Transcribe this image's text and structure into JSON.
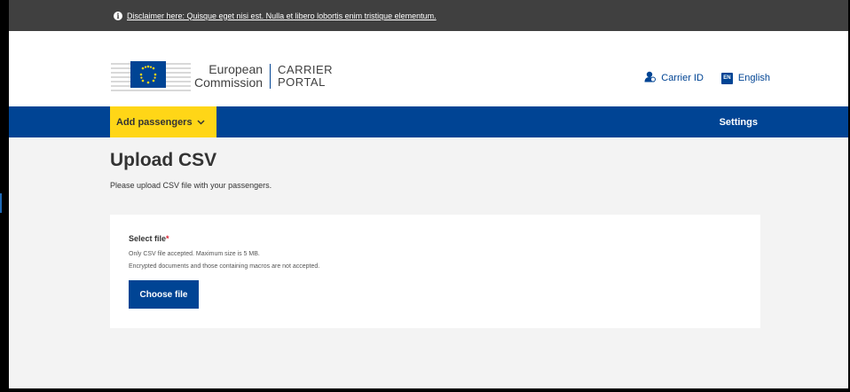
{
  "disclaimer": {
    "text": "Disclaimer here: Quisque eget nisi est. Nulla et libero lobortis enim tristique elementum."
  },
  "header": {
    "logo_line1": "European",
    "logo_line2": "Commission",
    "portal_line1": "CARRIER",
    "portal_line2": "PORTAL",
    "carrier_id_label": "Carrier ID",
    "language_code": "EN",
    "language_label": "English"
  },
  "nav": {
    "add_passengers_label": "Add passengers",
    "settings_label": "Settings"
  },
  "main": {
    "title": "Upload CSV",
    "subtitle": "Please upload CSV file with your passengers.",
    "card": {
      "label": "Select file",
      "required_mark": "*",
      "help1": "Only CSV file accepted. Maximum size is 5 MB.",
      "help2": "Encrypted documents and those containing macros are not accepted.",
      "button_label": "Choose file"
    }
  },
  "colors": {
    "primary": "#004494",
    "accent": "#ffd617",
    "disclaimer_bg": "#404040",
    "page_bg": "#f3f3f3"
  },
  "icons": [
    "info-icon",
    "eu-flag-icon",
    "user-id-icon",
    "language-icon",
    "chevron-down-icon"
  ]
}
